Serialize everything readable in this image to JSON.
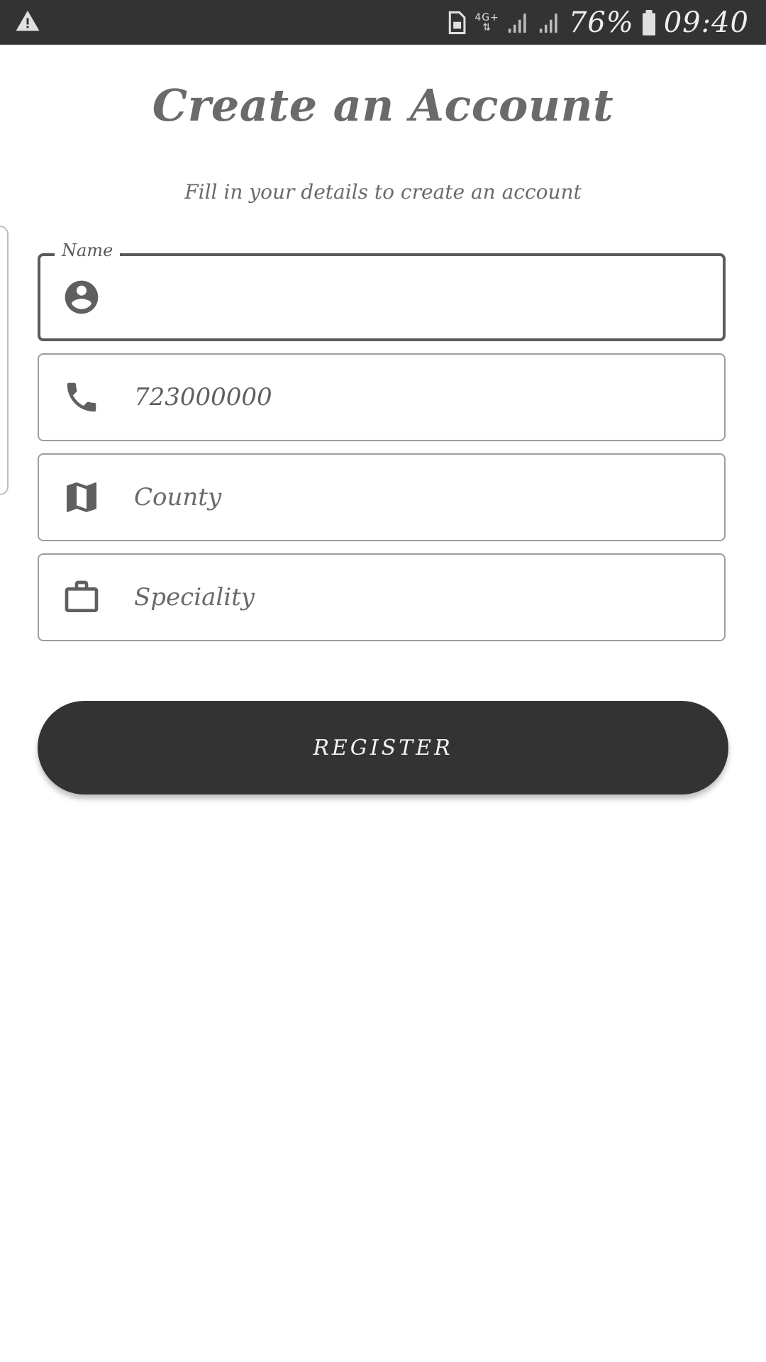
{
  "status_bar": {
    "battery": "76%",
    "time": "09:40",
    "network": "4G+",
    "icons": [
      "warning-icon",
      "sim-card-icon",
      "signal-icon",
      "battery-icon"
    ]
  },
  "header": {
    "title": "Create an Account",
    "subtitle": "Fill in your details to create an account"
  },
  "form": {
    "name": {
      "label": "Name",
      "value": "",
      "icon": "account-circle-icon"
    },
    "phone": {
      "value": "723000000",
      "icon": "phone-icon"
    },
    "county": {
      "placeholder": "County",
      "value": "",
      "icon": "map-icon"
    },
    "speciality": {
      "placeholder": "Speciality",
      "value": "",
      "icon": "briefcase-icon"
    },
    "register_label": "REGISTER"
  },
  "colors": {
    "status_bar_bg": "#333333",
    "button_bg": "#333333",
    "text_gray": "#6a6a6a",
    "border_gray": "#9e9e9e"
  }
}
